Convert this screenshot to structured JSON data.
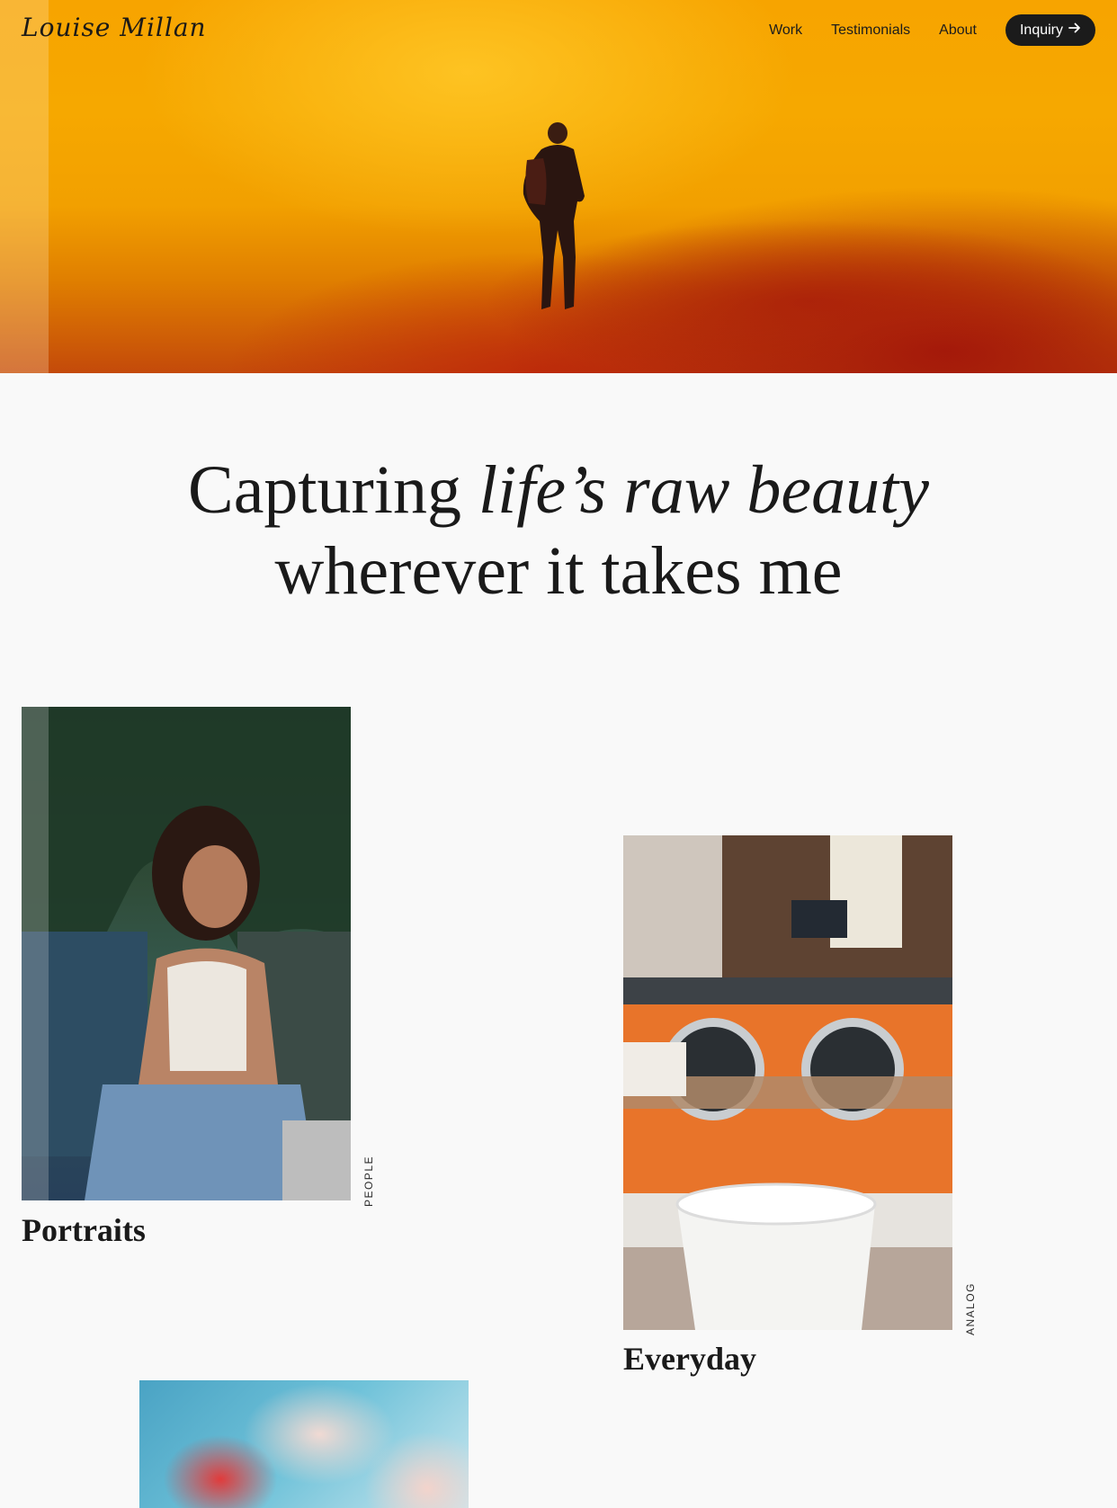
{
  "header": {
    "logo": "Louise Millan",
    "nav": [
      {
        "label": "Work"
      },
      {
        "label": "Testimonials"
      },
      {
        "label": "About"
      }
    ],
    "cta": {
      "label": "Inquiry",
      "icon": "arrow-right-icon"
    }
  },
  "hero": {
    "description_colors": {
      "sky": "#f7a400",
      "shore": "#c44a0a"
    }
  },
  "headline": {
    "part1": "Capturing ",
    "italic": "life’s raw beauty",
    "part2": "wherever it takes me"
  },
  "gallery": [
    {
      "title": "Portraits",
      "tag": "PEOPLE"
    },
    {
      "title": "Everyday",
      "tag": "ANALOG"
    },
    {
      "title": "",
      "tag": ""
    }
  ],
  "colors": {
    "background": "#f9f9f9",
    "text": "#1a1a1a",
    "button": "#1b1b1b"
  }
}
